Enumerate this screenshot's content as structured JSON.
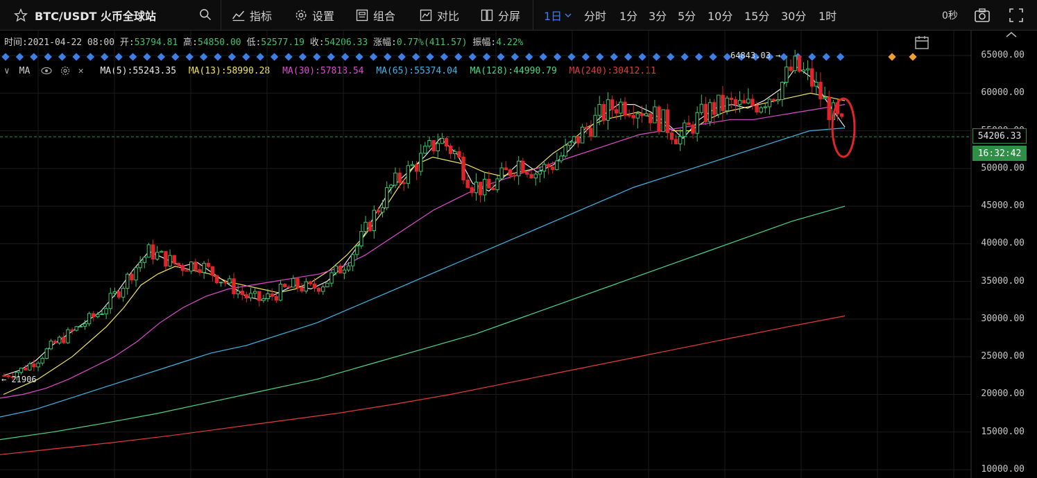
{
  "toolbar": {
    "symbol": "BTC/USDT 火币全球站",
    "indicators": "指标",
    "settings": "设置",
    "combo": "组合",
    "compare": "对比",
    "split": "分屏",
    "interval_active": "1日",
    "intervals": [
      "分时",
      "1分",
      "3分",
      "5分",
      "10分",
      "15分",
      "30分",
      "1时"
    ],
    "countdown": "0秒",
    "colors": {
      "accent": "#3d7fe6"
    }
  },
  "info": {
    "time_label": "时间:",
    "time": "2021-04-22 08:00",
    "open_label": "开:",
    "open": "53794.81",
    "high_label": "高:",
    "high": "54850.00",
    "low_label": "低:",
    "low": "52577.19",
    "close_label": "收:",
    "close": "54206.33",
    "change_label": "涨幅:",
    "change": "0.77%(411.57)",
    "amp_label": "振幅:",
    "amp": "4.22%"
  },
  "ma": {
    "name": "MA",
    "items": [
      {
        "label": "MA(5):55243.35",
        "color": "#e8e8e8"
      },
      {
        "label": "MA(13):58990.28",
        "color": "#f2e65c"
      },
      {
        "label": "MA(30):57818.54",
        "color": "#e04ad0"
      },
      {
        "label": "MA(65):55374.04",
        "color": "#3fb6e8"
      },
      {
        "label": "MA(128):44990.79",
        "color": "#48d88a"
      },
      {
        "label": "MA(240):30412.11",
        "color": "#e83a3a"
      }
    ]
  },
  "chart_data": {
    "type": "line",
    "y_ticks": [
      "65000.00",
      "60000.00",
      "55000.00",
      "50000.00",
      "45000.00",
      "40000.00",
      "35000.00",
      "30000.00",
      "25000.00",
      "20000.00",
      "15000.00",
      "10000.00"
    ],
    "ylim": [
      10000,
      66000
    ],
    "markers": {
      "high": "64843.03 →",
      "low": "← 21906"
    },
    "last_price": "54206.33",
    "countdown_tag": "16:32:42",
    "price_tag_color": "#2f8f46",
    "up_color": "#3ec46d",
    "down_color": "#e0242a",
    "series": [
      {
        "name": "MA(5)",
        "color": "#e8e8e8",
        "values": [
          22500,
          23200,
          24500,
          26500,
          28000,
          29500,
          31000,
          33500,
          36500,
          39000,
          38000,
          37000,
          37500,
          36000,
          34500,
          33000,
          32500,
          33500,
          34500,
          34000,
          35000,
          37000,
          40000,
          44000,
          47500,
          49500,
          51500,
          54000,
          52000,
          48000,
          47000,
          49000,
          51000,
          49500,
          50500,
          52500,
          55000,
          57000,
          58500,
          58500,
          57500,
          56000,
          54000,
          56500,
          58000,
          58500,
          58000,
          59000,
          60500,
          63500,
          62000,
          58500,
          55500
        ]
      },
      {
        "name": "MA(13)",
        "color": "#f2e65c",
        "values": [
          20000,
          21000,
          22000,
          23500,
          25000,
          27000,
          29000,
          31500,
          34500,
          36000,
          37000,
          36500,
          36000,
          35000,
          34500,
          34000,
          33500,
          34000,
          35000,
          36500,
          38500,
          41000,
          44000,
          47500,
          50500,
          51500,
          51000,
          50500,
          49500,
          49000,
          49500,
          50000,
          52000,
          53500,
          55500,
          56500,
          57000,
          57500,
          56500,
          55000,
          55000,
          56500,
          57500,
          58000,
          58500,
          59000,
          59500,
          60000,
          59500,
          59000
        ]
      },
      {
        "name": "MA(30)",
        "color": "#e04ad0",
        "values": [
          19500,
          20000,
          20800,
          22000,
          23500,
          25000,
          27000,
          29500,
          31500,
          33000,
          34000,
          34500,
          35000,
          35500,
          36000,
          37000,
          38500,
          40500,
          42500,
          44500,
          46000,
          47500,
          48500,
          49500,
          50500,
          51500,
          52500,
          53500,
          54500,
          55000,
          55500,
          56000,
          56500,
          56500,
          57000,
          57500,
          58000,
          58500
        ]
      },
      {
        "name": "MA(65)",
        "color": "#3fb6e8",
        "values": [
          17000,
          18000,
          19500,
          21000,
          22500,
          24000,
          25500,
          26500,
          28000,
          29500,
          31500,
          33500,
          35500,
          37500,
          39500,
          41500,
          43500,
          45500,
          47500,
          49000,
          50500,
          52000,
          53500,
          55000,
          55374
        ]
      },
      {
        "name": "MA(128)",
        "color": "#48d88a",
        "values": [
          14000,
          15000,
          16200,
          17500,
          19000,
          20500,
          22000,
          24000,
          26000,
          28000,
          30500,
          33000,
          35500,
          38000,
          40500,
          43000,
          44990
        ]
      },
      {
        "name": "MA(240)",
        "color": "#e83a3a",
        "values": [
          12000,
          12800,
          13600,
          14500,
          15500,
          16500,
          17500,
          18700,
          20000,
          21500,
          23000,
          24500,
          26000,
          27500,
          29000,
          30412
        ]
      }
    ]
  }
}
